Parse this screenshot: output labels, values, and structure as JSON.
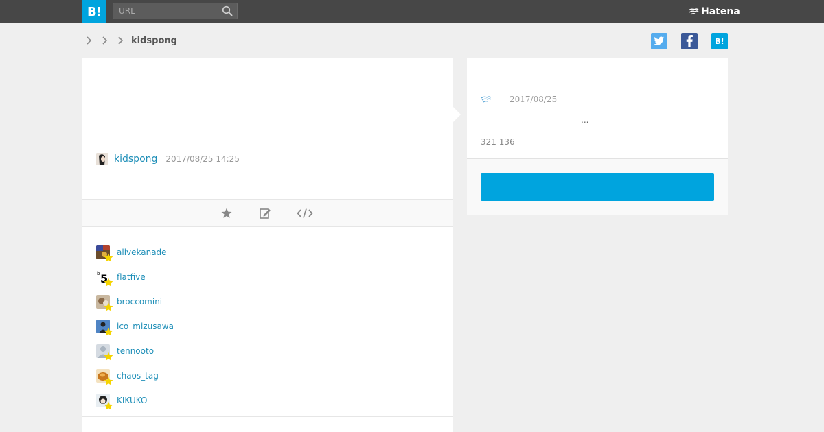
{
  "header": {
    "logo_text": "B!",
    "search_placeholder": "URL",
    "brand_text": "Hatena"
  },
  "breadcrumb": {
    "current": "kidspong"
  },
  "share": {
    "hatena_label": "B!"
  },
  "entry": {
    "author": "kidspong",
    "date": "2017/08/25 14:25"
  },
  "users": [
    {
      "name": "alivekanade"
    },
    {
      "name": "flatfive"
    },
    {
      "name": "broccomini"
    },
    {
      "name": "ico_mizusawa"
    },
    {
      "name": "tennooto"
    },
    {
      "name": "chaos_tag"
    },
    {
      "name": "KIKUKO"
    }
  ],
  "sidebar": {
    "date": "2017/08/25",
    "ellipsis": "...",
    "counts": "321 136"
  },
  "colors": {
    "accent": "#00a4de",
    "link": "#1f8fb8",
    "topbar": "#474747",
    "twitter": "#55acee",
    "facebook": "#3b5998",
    "star": "#f5d400"
  }
}
